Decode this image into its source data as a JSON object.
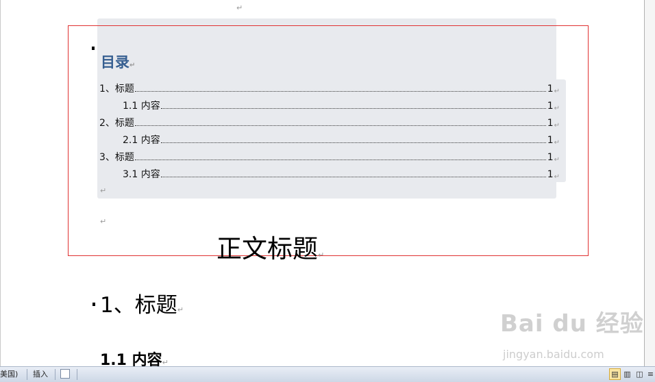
{
  "marks": {
    "paragraph": "↵"
  },
  "toc": {
    "title": "目录",
    "entries": [
      {
        "text": "1、标题",
        "page": "1"
      },
      {
        "text": "1.1 内容",
        "page": "1"
      },
      {
        "text": "2、标题",
        "page": "1"
      },
      {
        "text": "2.1 内容",
        "page": "1"
      },
      {
        "text": "3、标题",
        "page": "1"
      },
      {
        "text": "3.1 内容",
        "page": "1"
      }
    ]
  },
  "body": {
    "title": "正文标题",
    "heading1": "1、标题",
    "heading2": "1.1 内容"
  },
  "watermark": {
    "logo": "Bai du 经验",
    "url": "jingyan.baidu.com"
  },
  "statusbar": {
    "language": "美国)",
    "mode": "插入"
  }
}
